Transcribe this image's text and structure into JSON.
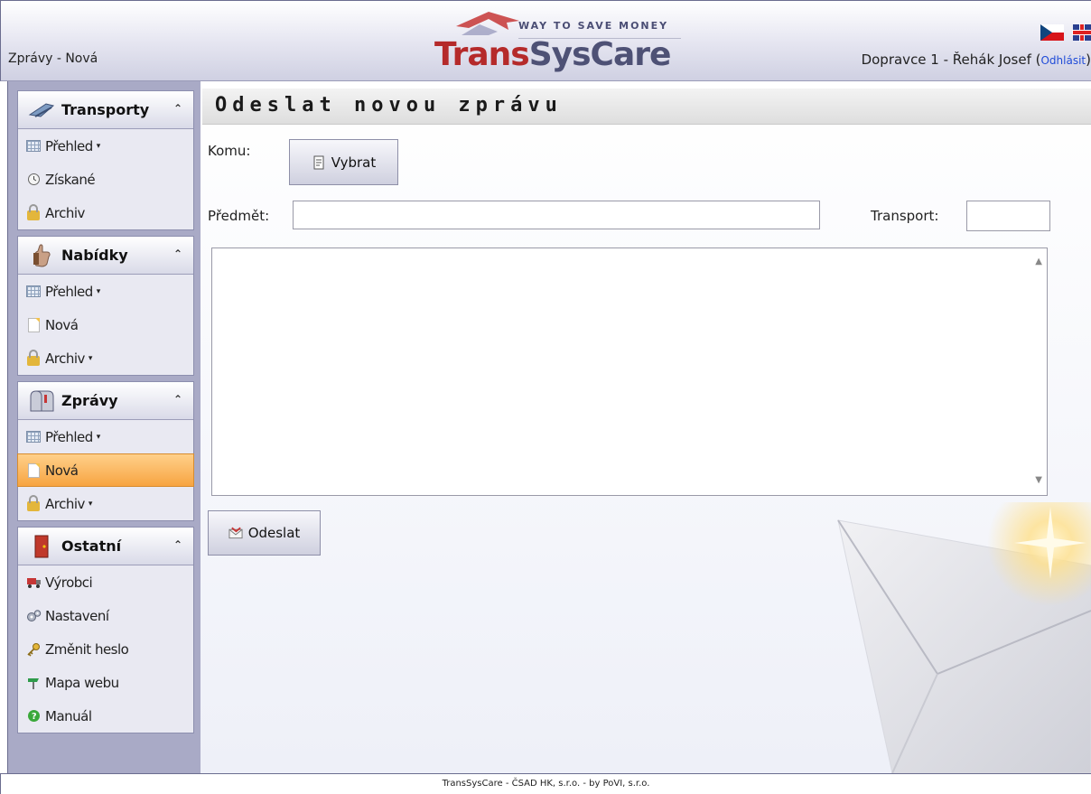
{
  "header": {
    "breadcrumb": "Zprávy - Nová",
    "logo_tagline": "WAY TO SAVE MONEY",
    "logo_name_part1": "Trans",
    "logo_name_part2": "SysCare",
    "user_text": "Dopravce 1 - Řehák Josef (",
    "logout_label": "Odhlásit",
    "user_suffix": ")"
  },
  "sidebar": {
    "panels": [
      {
        "title": "Transporty",
        "items": [
          {
            "label": "Přehled",
            "has_caret": true,
            "icon": "table-icon"
          },
          {
            "label": "Získané",
            "has_caret": false,
            "icon": "clock-icon"
          },
          {
            "label": "Archiv",
            "has_caret": false,
            "icon": "lock-icon"
          }
        ]
      },
      {
        "title": "Nabídky",
        "items": [
          {
            "label": "Přehled",
            "has_caret": true,
            "icon": "table-icon"
          },
          {
            "label": "Nová",
            "has_caret": false,
            "icon": "new-document-icon"
          },
          {
            "label": "Archiv",
            "has_caret": true,
            "icon": "lock-icon"
          }
        ]
      },
      {
        "title": "Zprávy",
        "items": [
          {
            "label": "Přehled",
            "has_caret": true,
            "icon": "table-icon"
          },
          {
            "label": "Nová",
            "has_caret": false,
            "icon": "new-document-icon",
            "active": true
          },
          {
            "label": "Archiv",
            "has_caret": true,
            "icon": "lock-icon"
          }
        ]
      },
      {
        "title": "Ostatní",
        "items": [
          {
            "label": "Výrobci",
            "icon": "truck-icon"
          },
          {
            "label": "Nastavení",
            "icon": "gears-icon"
          },
          {
            "label": "Změnit heslo",
            "icon": "key-icon"
          },
          {
            "label": "Mapa webu",
            "icon": "signpost-icon"
          },
          {
            "label": "Manuál",
            "icon": "help-icon"
          }
        ]
      }
    ],
    "caret_glyph": "▾",
    "collapse_glyph": "≈"
  },
  "main": {
    "title": "Odeslat novou zprávu",
    "to_label": "Komu:",
    "choose_button": "Vybrat",
    "subject_label": "Předmět:",
    "subject_value": "",
    "transport_label": "Transport:",
    "transport_value": "",
    "message_value": "",
    "send_button": "Odeslat"
  },
  "footer": {
    "text": "TransSysCare - ČSAD HK, s.r.o. - by PoVI, s.r.o."
  },
  "colors": {
    "accent_red": "#b52a2a",
    "brand_slate": "#4e5175",
    "sidebar_bg": "#a9aac6",
    "active_orange": "#f7a441",
    "link_blue": "#1f4bd8"
  }
}
